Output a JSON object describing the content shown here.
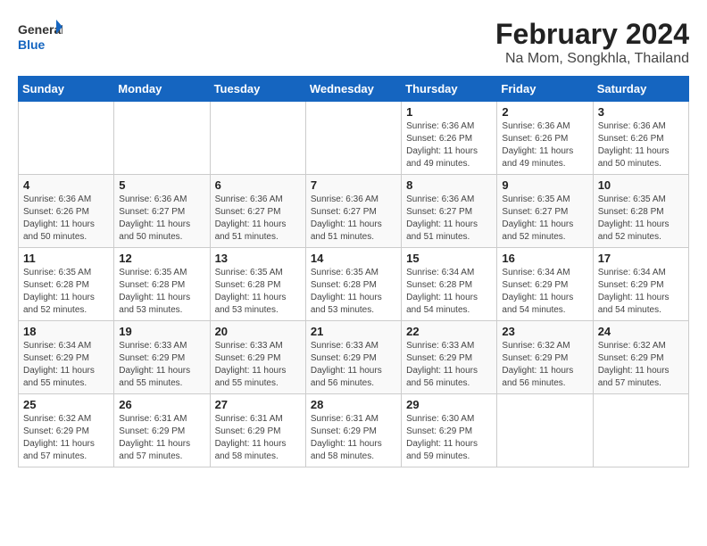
{
  "header": {
    "logo": {
      "general": "General",
      "blue": "Blue"
    },
    "title": "February 2024",
    "location": "Na Mom, Songkhla, Thailand"
  },
  "calendar": {
    "days_of_week": [
      "Sunday",
      "Monday",
      "Tuesday",
      "Wednesday",
      "Thursday",
      "Friday",
      "Saturday"
    ],
    "weeks": [
      [
        {
          "day": "",
          "info": ""
        },
        {
          "day": "",
          "info": ""
        },
        {
          "day": "",
          "info": ""
        },
        {
          "day": "",
          "info": ""
        },
        {
          "day": "1",
          "info": "Sunrise: 6:36 AM\nSunset: 6:26 PM\nDaylight: 11 hours and 49 minutes."
        },
        {
          "day": "2",
          "info": "Sunrise: 6:36 AM\nSunset: 6:26 PM\nDaylight: 11 hours and 49 minutes."
        },
        {
          "day": "3",
          "info": "Sunrise: 6:36 AM\nSunset: 6:26 PM\nDaylight: 11 hours and 50 minutes."
        }
      ],
      [
        {
          "day": "4",
          "info": "Sunrise: 6:36 AM\nSunset: 6:26 PM\nDaylight: 11 hours and 50 minutes."
        },
        {
          "day": "5",
          "info": "Sunrise: 6:36 AM\nSunset: 6:27 PM\nDaylight: 11 hours and 50 minutes."
        },
        {
          "day": "6",
          "info": "Sunrise: 6:36 AM\nSunset: 6:27 PM\nDaylight: 11 hours and 51 minutes."
        },
        {
          "day": "7",
          "info": "Sunrise: 6:36 AM\nSunset: 6:27 PM\nDaylight: 11 hours and 51 minutes."
        },
        {
          "day": "8",
          "info": "Sunrise: 6:36 AM\nSunset: 6:27 PM\nDaylight: 11 hours and 51 minutes."
        },
        {
          "day": "9",
          "info": "Sunrise: 6:35 AM\nSunset: 6:27 PM\nDaylight: 11 hours and 52 minutes."
        },
        {
          "day": "10",
          "info": "Sunrise: 6:35 AM\nSunset: 6:28 PM\nDaylight: 11 hours and 52 minutes."
        }
      ],
      [
        {
          "day": "11",
          "info": "Sunrise: 6:35 AM\nSunset: 6:28 PM\nDaylight: 11 hours and 52 minutes."
        },
        {
          "day": "12",
          "info": "Sunrise: 6:35 AM\nSunset: 6:28 PM\nDaylight: 11 hours and 53 minutes."
        },
        {
          "day": "13",
          "info": "Sunrise: 6:35 AM\nSunset: 6:28 PM\nDaylight: 11 hours and 53 minutes."
        },
        {
          "day": "14",
          "info": "Sunrise: 6:35 AM\nSunset: 6:28 PM\nDaylight: 11 hours and 53 minutes."
        },
        {
          "day": "15",
          "info": "Sunrise: 6:34 AM\nSunset: 6:28 PM\nDaylight: 11 hours and 54 minutes."
        },
        {
          "day": "16",
          "info": "Sunrise: 6:34 AM\nSunset: 6:29 PM\nDaylight: 11 hours and 54 minutes."
        },
        {
          "day": "17",
          "info": "Sunrise: 6:34 AM\nSunset: 6:29 PM\nDaylight: 11 hours and 54 minutes."
        }
      ],
      [
        {
          "day": "18",
          "info": "Sunrise: 6:34 AM\nSunset: 6:29 PM\nDaylight: 11 hours and 55 minutes."
        },
        {
          "day": "19",
          "info": "Sunrise: 6:33 AM\nSunset: 6:29 PM\nDaylight: 11 hours and 55 minutes."
        },
        {
          "day": "20",
          "info": "Sunrise: 6:33 AM\nSunset: 6:29 PM\nDaylight: 11 hours and 55 minutes."
        },
        {
          "day": "21",
          "info": "Sunrise: 6:33 AM\nSunset: 6:29 PM\nDaylight: 11 hours and 56 minutes."
        },
        {
          "day": "22",
          "info": "Sunrise: 6:33 AM\nSunset: 6:29 PM\nDaylight: 11 hours and 56 minutes."
        },
        {
          "day": "23",
          "info": "Sunrise: 6:32 AM\nSunset: 6:29 PM\nDaylight: 11 hours and 56 minutes."
        },
        {
          "day": "24",
          "info": "Sunrise: 6:32 AM\nSunset: 6:29 PM\nDaylight: 11 hours and 57 minutes."
        }
      ],
      [
        {
          "day": "25",
          "info": "Sunrise: 6:32 AM\nSunset: 6:29 PM\nDaylight: 11 hours and 57 minutes."
        },
        {
          "day": "26",
          "info": "Sunrise: 6:31 AM\nSunset: 6:29 PM\nDaylight: 11 hours and 57 minutes."
        },
        {
          "day": "27",
          "info": "Sunrise: 6:31 AM\nSunset: 6:29 PM\nDaylight: 11 hours and 58 minutes."
        },
        {
          "day": "28",
          "info": "Sunrise: 6:31 AM\nSunset: 6:29 PM\nDaylight: 11 hours and 58 minutes."
        },
        {
          "day": "29",
          "info": "Sunrise: 6:30 AM\nSunset: 6:29 PM\nDaylight: 11 hours and 59 minutes."
        },
        {
          "day": "",
          "info": ""
        },
        {
          "day": "",
          "info": ""
        }
      ]
    ]
  }
}
